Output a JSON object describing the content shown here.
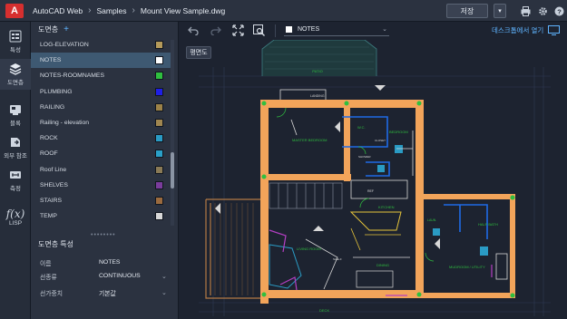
{
  "header": {
    "logo_letter": "A",
    "app_name": "AutoCAD Web",
    "crumb_folder": "Samples",
    "crumb_file": "Mount View Sample.dwg",
    "save_label": "저장",
    "save_dropdown": "▾"
  },
  "rail": {
    "properties": "특성",
    "layers": "도면층",
    "blocks": "블록",
    "xrefs": "외부 참조",
    "measure": "측정",
    "lisp": "LISP"
  },
  "layers_panel": {
    "title": "도면층",
    "add_icon": "+",
    "items": [
      {
        "name": "LOG-ELEVATION",
        "color": "#b59a5a"
      },
      {
        "name": "NOTES",
        "color": "#ffffff"
      },
      {
        "name": "NOTES-ROOMNAMES",
        "color": "#2fbf3f"
      },
      {
        "name": "PLUMBING",
        "color": "#1f1fe6"
      },
      {
        "name": "RAILING",
        "color": "#9c8248"
      },
      {
        "name": "Railing - elevation",
        "color": "#a08650"
      },
      {
        "name": "ROCK",
        "color": "#2a9bc4"
      },
      {
        "name": "ROOF",
        "color": "#2aa0c8"
      },
      {
        "name": "Roof Line",
        "color": "#8a7a56"
      },
      {
        "name": "SHELVES",
        "color": "#7a3c9c"
      },
      {
        "name": "STAIRS",
        "color": "#9a6a3e"
      },
      {
        "name": "TEMP",
        "color": "#d8d8d8"
      }
    ],
    "selected_index": 1
  },
  "layer_props": {
    "title": "도면층 특성",
    "rows": [
      {
        "key": "이름",
        "value": "NOTES"
      },
      {
        "key": "선종류",
        "value": "CONTINUOUS"
      },
      {
        "key": "선가중치",
        "value": "기본값"
      }
    ]
  },
  "canvas": {
    "current_layer": "NOTES",
    "open_desktop": "데스크톱에서 열기",
    "view_tab": "평면도"
  },
  "plan_labels": {
    "patio": "PATIO",
    "landing": "LANDING",
    "master_bedroom": "MASTER\nBEDROOM",
    "wc": "W.C.",
    "closet": "CLOSET",
    "shower": "SHOWER",
    "bedroom": "BEDROOM",
    "ref": "REF",
    "kitchen": "KITCHEN",
    "living_room": "LIVING\nROOM",
    "dining": "DINING",
    "half_bath": "HALF\nBATH",
    "mudroom": "MUDROOM /\nUTILITY",
    "laundry": "LAUN.",
    "deck": "DECK",
    "shelf": "SHELF"
  }
}
